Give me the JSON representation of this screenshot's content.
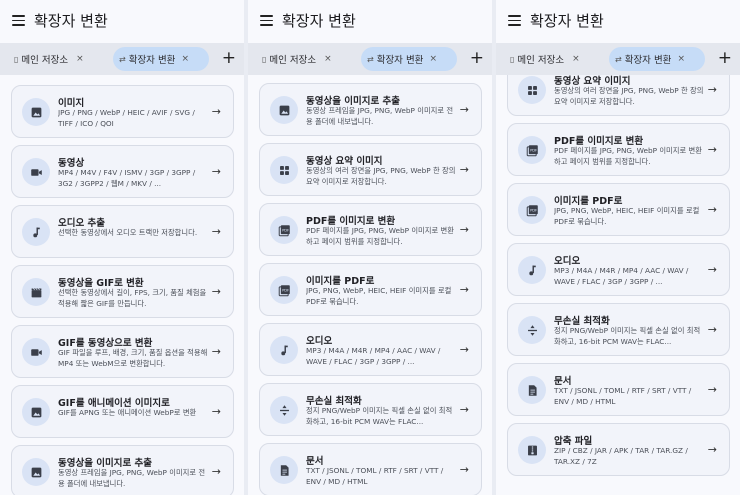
{
  "app": {
    "title": "확장자 변환",
    "tab_storage": "메인 저장소",
    "tab_convert": "확장자 변환",
    "tab_close": "×",
    "add_tab": "+"
  },
  "icons": [
    "menu-icon",
    "phone-icon",
    "swap-icon",
    "close-icon",
    "plus-icon",
    "image-icon",
    "video-icon",
    "music-note-icon",
    "clapperboard-icon",
    "grid-icon",
    "pdf-icon",
    "equal-split-icon",
    "document-icon",
    "archive-icon",
    "arrow-right-icon"
  ],
  "colors": {
    "active_tab": "#c6dcf7",
    "card": "#f2f4fa",
    "icon_bg": "#d9e3f5"
  },
  "panel1": {
    "cards": [
      {
        "title": "이미지",
        "desc": "JPG / PNG / WebP / HEIC / AVIF / SVG / TIFF / ICO / QOI"
      },
      {
        "title": "동영상",
        "desc": "MP4 / M4V / F4V / ISMV / 3GP / 3GPP / 3G2 / 3GPP2 / 웹M / MKV / ..."
      },
      {
        "title": "오디오 추출",
        "desc": "선택한 동영상에서 오디오 트랙만 저장합니다."
      },
      {
        "title": "동영상을 GIF로 변환",
        "desc": "선택한 동영상에서 길이, FPS, 크기, 품질 체험을 적용해 짧은 GIF를 만듭니다."
      },
      {
        "title": "GIF를 동영상으로 변환",
        "desc": "GIF 파일을 루프, 배경, 크기, 품질 옵션을 적용해 MP4 또는 WebM으로 변환합니다."
      },
      {
        "title": "GIF를 애니메이션 이미지로",
        "desc": "GIF를 APNG 또는 애니메이션 WebP로 변환"
      },
      {
        "title": "동영상을 이미지로 추출",
        "desc": "동영상 프레임을 JPG, PNG, WebP 이미지로 전용 폴더에 내보냅니다."
      }
    ]
  },
  "panel2": {
    "cards": [
      {
        "title": "동영상을 이미지로 추출",
        "desc": "동영상 프레임을 JPG, PNG, WebP 이미지로 전용 폴더에 내보냅니다."
      },
      {
        "title": "동영상 요약 이미지",
        "desc": "동영상의 여러 장면을 JPG, PNG, WebP 한 장의 요약 이미지로 저장합니다."
      },
      {
        "title": "PDF를 이미지로 변환",
        "desc": "PDF 페이지를 JPG, PNG, WebP 이미지로 변환하고 페이지 범위를 지정합니다."
      },
      {
        "title": "이미지를 PDF로",
        "desc": "JPG, PNG, WebP, HEIC, HEIF 이미지를 로컬 PDF로 묶습니다."
      },
      {
        "title": "오디오",
        "desc": "MP3 / M4A / M4R / MP4 / AAC / WAV / WAVE / FLAC / 3GP / 3GPP / ..."
      },
      {
        "title": "무손실 최적화",
        "desc": "정지 PNG/WebP 이미지는 픽셀 손실 없이 최적화하고, 16-bit PCM WAV는 FLAC..."
      },
      {
        "title": "문서",
        "desc": "TXT / JSONL / TOML / RTF / SRT / VTT / ENV / MD / HTML"
      }
    ]
  },
  "panel3": {
    "cards": [
      {
        "title": "동영상 요약 이미지",
        "desc": "동영상의 여러 장면을 JPG, PNG, WebP 한 장의 요약 이미지로 저장합니다."
      },
      {
        "title": "PDF를 이미지로 변환",
        "desc": "PDF 페이지를 JPG, PNG, WebP 이미지로 변환하고 페이지 범위를 지정합니다."
      },
      {
        "title": "이미지를 PDF로",
        "desc": "JPG, PNG, WebP, HEIC, HEIF 이미지를 로컬 PDF로 묶습니다."
      },
      {
        "title": "오디오",
        "desc": "MP3 / M4A / M4R / MP4 / AAC / WAV / WAVE / FLAC / 3GP / 3GPP / ..."
      },
      {
        "title": "무손실 최적화",
        "desc": "정지 PNG/WebP 이미지는 픽셀 손실 없이 최적화하고, 16-bit PCM WAV는 FLAC..."
      },
      {
        "title": "문서",
        "desc": "TXT / JSONL / TOML / RTF / SRT / VTT / ENV / MD / HTML"
      },
      {
        "title": "압축 파일",
        "desc": "ZIP / CBZ / JAR / APK / TAR / TAR.GZ / TAR.XZ / 7Z"
      }
    ]
  }
}
